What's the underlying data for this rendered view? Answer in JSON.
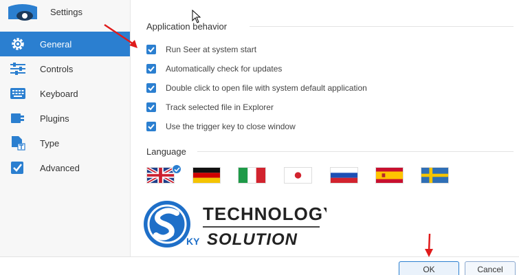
{
  "app": {
    "title": "Settings"
  },
  "sidebar": {
    "items": [
      {
        "label": "General",
        "icon": "gear-icon",
        "active": true
      },
      {
        "label": "Controls",
        "icon": "sliders-icon",
        "active": false
      },
      {
        "label": "Keyboard",
        "icon": "keyboard-icon",
        "active": false
      },
      {
        "label": "Plugins",
        "icon": "plugin-icon",
        "active": false
      },
      {
        "label": "Type",
        "icon": "file-type-icon",
        "active": false
      },
      {
        "label": "Advanced",
        "icon": "checkbox-icon",
        "active": false
      }
    ]
  },
  "general": {
    "behavior_title": "Application behavior",
    "options": [
      {
        "label": "Run Seer at system start",
        "checked": true
      },
      {
        "label": "Automatically check for updates",
        "checked": true
      },
      {
        "label": "Double click to open file with system default application",
        "checked": true
      },
      {
        "label": "Track selected file in Explorer",
        "checked": true
      },
      {
        "label": "Use the trigger key to close window",
        "checked": true
      }
    ],
    "language_title": "Language",
    "languages": [
      {
        "flag": "uk-flag-icon",
        "selected": true
      },
      {
        "flag": "germany-flag-icon",
        "selected": false
      },
      {
        "flag": "italy-flag-icon",
        "selected": false
      },
      {
        "flag": "japan-flag-icon",
        "selected": false
      },
      {
        "flag": "russia-flag-icon",
        "selected": false
      },
      {
        "flag": "spain-flag-icon",
        "selected": false
      },
      {
        "flag": "sweden-flag-icon",
        "selected": false
      }
    ]
  },
  "watermark": {
    "line1": "TECHNOLOGY",
    "line2": "SOLUTION",
    "badge": "KY"
  },
  "footer": {
    "ok_label": "OK",
    "cancel_label": "Cancel"
  },
  "colors": {
    "accent": "#2b7fd0",
    "annotation_red": "#e01b1b",
    "sidebar_bg": "#f7f7f7"
  }
}
